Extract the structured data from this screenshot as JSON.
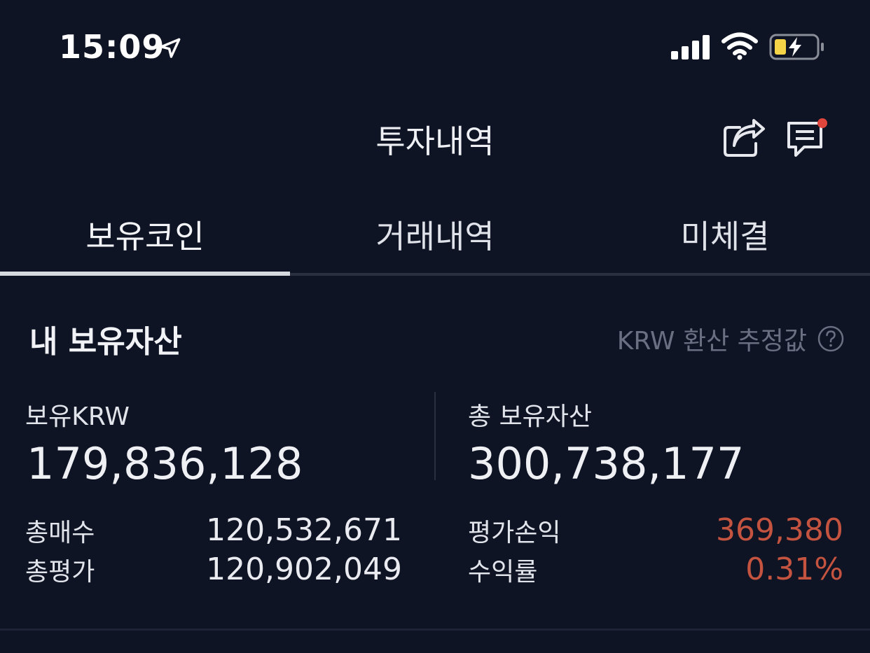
{
  "status_bar": {
    "time": "15:09"
  },
  "header": {
    "title": "투자내역"
  },
  "tabs": [
    {
      "label": "보유코인",
      "active": true
    },
    {
      "label": "거래내역",
      "active": false
    },
    {
      "label": "미체결",
      "active": false
    }
  ],
  "assets": {
    "title": "내 보유자산",
    "estimate_note": "KRW 환산 추정값",
    "krw_label": "보유KRW",
    "krw_value": "179,836,128",
    "total_label": "총 보유자산",
    "total_value": "300,738,177",
    "rows": {
      "total_buy_label": "총매수",
      "total_buy_value": "120,532,671",
      "total_eval_label": "총평가",
      "total_eval_value": "120,902,049",
      "pnl_label": "평가손익",
      "pnl_value": "369,380",
      "return_label": "수익률",
      "return_value": "0.31%"
    }
  },
  "colors": {
    "background": "#0f1424",
    "profit": "#c4533f",
    "notification_dot": "#e0463c"
  },
  "icons": [
    "location-arrow-icon",
    "signal-icon",
    "wifi-icon",
    "battery-charging-icon",
    "share-icon",
    "chat-icon",
    "help-icon"
  ]
}
